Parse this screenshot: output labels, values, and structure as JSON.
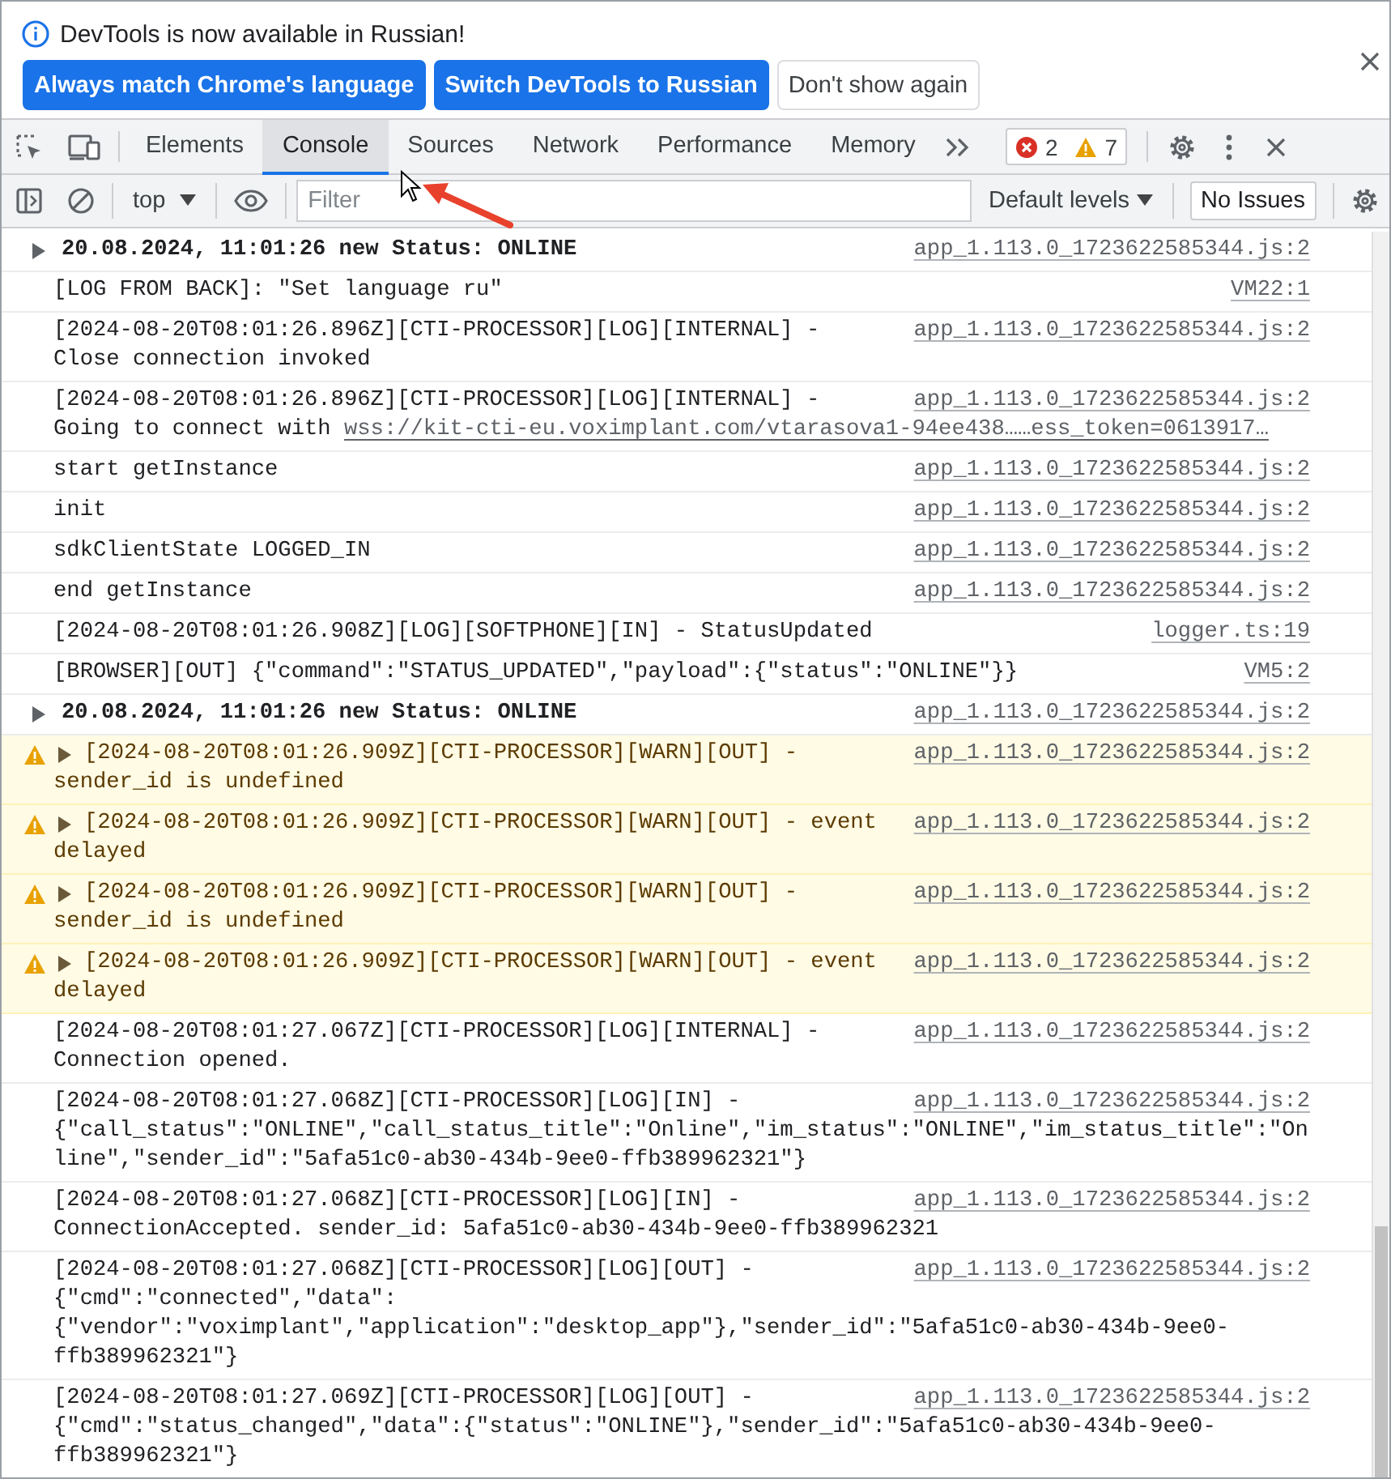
{
  "banner": {
    "message": "DevTools is now available in Russian!",
    "buttons": [
      {
        "label": "Always match Chrome's language",
        "kind": "primary"
      },
      {
        "label": "Switch DevTools to Russian",
        "kind": "primary"
      },
      {
        "label": "Don't show again",
        "kind": "secondary"
      }
    ]
  },
  "tabs": [
    {
      "label": "Elements",
      "selected": false
    },
    {
      "label": "Console",
      "selected": true
    },
    {
      "label": "Sources",
      "selected": false
    },
    {
      "label": "Network",
      "selected": false
    },
    {
      "label": "Performance",
      "selected": false
    },
    {
      "label": "Memory",
      "selected": false
    }
  ],
  "counters": {
    "errors": "2",
    "warnings": "7"
  },
  "toolbar": {
    "context": "top",
    "filter": {
      "placeholder": "Filter"
    },
    "levels": "Default levels",
    "issues": "No Issues"
  },
  "console": [
    {
      "kind": "group",
      "lines": [
        "20.08.2024, 11:01:26 new Status: ONLINE"
      ],
      "source": "app_1.113.0_1723622585344.js:2"
    },
    {
      "kind": "log",
      "lines": [
        "[LOG FROM BACK]: \"Set language ru\""
      ],
      "source": "VM22:1"
    },
    {
      "kind": "log",
      "lines": [
        "[2024-08-20T08:01:26.896Z][CTI-PROCESSOR][LOG][INTERNAL] -",
        "Close connection invoked"
      ],
      "source": "app_1.113.0_1723622585344.js:2"
    },
    {
      "kind": "log",
      "lines": [
        "[2024-08-20T08:01:26.896Z][CTI-PROCESSOR][LOG][INTERNAL] -",
        "Going to connect with"
      ],
      "link": "wss://kit-cti-eu.voximplant.com/vtarasova1-94ee438……ess_token=0613917…",
      "source": "app_1.113.0_1723622585344.js:2"
    },
    {
      "kind": "log",
      "lines": [
        "start getInstance"
      ],
      "source": "app_1.113.0_1723622585344.js:2"
    },
    {
      "kind": "log",
      "lines": [
        "init"
      ],
      "source": "app_1.113.0_1723622585344.js:2"
    },
    {
      "kind": "log",
      "lines": [
        "sdkClientState LOGGED_IN"
      ],
      "source": "app_1.113.0_1723622585344.js:2"
    },
    {
      "kind": "log",
      "lines": [
        "end getInstance"
      ],
      "source": "app_1.113.0_1723622585344.js:2"
    },
    {
      "kind": "log",
      "lines": [
        "[2024-08-20T08:01:26.908Z][LOG][SOFTPHONE][IN] - StatusUpdated"
      ],
      "source": "logger.ts:19"
    },
    {
      "kind": "log",
      "lines": [
        "[BROWSER][OUT] {\"command\":\"STATUS_UPDATED\",\"payload\":{\"status\":\"ONLINE\"}}"
      ],
      "source": "VM5:2"
    },
    {
      "kind": "group",
      "lines": [
        "20.08.2024, 11:01:26 new Status: ONLINE"
      ],
      "source": "app_1.113.0_1723622585344.js:2"
    },
    {
      "kind": "warn",
      "lines": [
        "[2024-08-20T08:01:26.909Z][CTI-PROCESSOR][WARN][OUT] -",
        "sender_id is undefined"
      ],
      "source": "app_1.113.0_1723622585344.js:2"
    },
    {
      "kind": "warn",
      "lines": [
        "[2024-08-20T08:01:26.909Z][CTI-PROCESSOR][WARN][OUT] - event",
        "delayed"
      ],
      "source": "app_1.113.0_1723622585344.js:2"
    },
    {
      "kind": "warn",
      "lines": [
        "[2024-08-20T08:01:26.909Z][CTI-PROCESSOR][WARN][OUT] -",
        "sender_id is undefined"
      ],
      "source": "app_1.113.0_1723622585344.js:2"
    },
    {
      "kind": "warn",
      "lines": [
        "[2024-08-20T08:01:26.909Z][CTI-PROCESSOR][WARN][OUT] - event",
        "delayed"
      ],
      "source": "app_1.113.0_1723622585344.js:2"
    },
    {
      "kind": "log",
      "lines": [
        "[2024-08-20T08:01:27.067Z][CTI-PROCESSOR][LOG][INTERNAL] -",
        "Connection opened."
      ],
      "source": "app_1.113.0_1723622585344.js:2"
    },
    {
      "kind": "log",
      "lines": [
        "[2024-08-20T08:01:27.068Z][CTI-PROCESSOR][LOG][IN] -",
        "{\"call_status\":\"ONLINE\",\"call_status_title\":\"Online\",\"im_status\":\"ONLINE\",\"im_status_title\":\"On",
        "line\",\"sender_id\":\"5afa51c0-ab30-434b-9ee0-ffb389962321\"}"
      ],
      "source": "app_1.113.0_1723622585344.js:2"
    },
    {
      "kind": "log",
      "lines": [
        "[2024-08-20T08:01:27.068Z][CTI-PROCESSOR][LOG][IN] -",
        "ConnectionAccepted. sender_id: 5afa51c0-ab30-434b-9ee0-ffb389962321"
      ],
      "source": "app_1.113.0_1723622585344.js:2"
    },
    {
      "kind": "log",
      "lines": [
        "[2024-08-20T08:01:27.068Z][CTI-PROCESSOR][LOG][OUT] -",
        "{\"cmd\":\"connected\",\"data\":",
        "{\"vendor\":\"voximplant\",\"application\":\"desktop_app\"},\"sender_id\":\"5afa51c0-ab30-434b-9ee0-",
        "ffb389962321\"}"
      ],
      "source": "app_1.113.0_1723622585344.js:2"
    },
    {
      "kind": "log",
      "lines": [
        "[2024-08-20T08:01:27.069Z][CTI-PROCESSOR][LOG][OUT] -",
        "{\"cmd\":\"status_changed\",\"data\":{\"status\":\"ONLINE\"},\"sender_id\":\"5afa51c0-ab30-434b-9ee0-",
        "ffb389962321\"}"
      ],
      "source": "app_1.113.0_1723622585344.js:2"
    }
  ]
}
